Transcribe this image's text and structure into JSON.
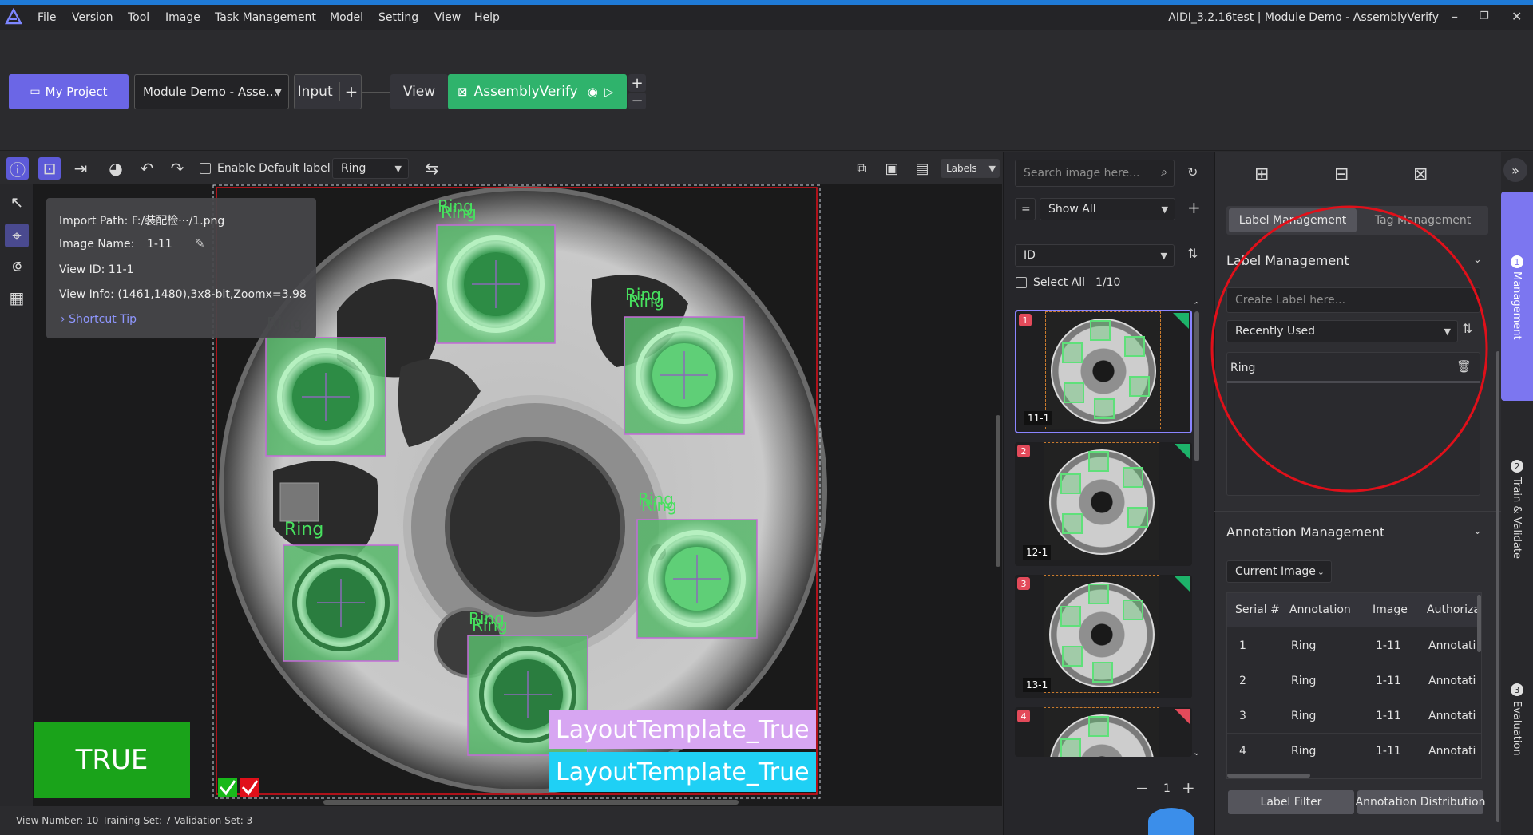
{
  "title_bar": {
    "window_title": "AIDI_3.2.16test | Module Demo - AssemblyVerify",
    "menu": [
      "File",
      "Version",
      "Tool",
      "Image",
      "Task Management",
      "Model",
      "Setting",
      "View",
      "Help"
    ]
  },
  "project_bar": {
    "my_project": "My Project",
    "project_select": "Module Demo - Asse...",
    "input_label": "Input",
    "view_label": "View",
    "module_label": "AssemblyVerify",
    "plus": "+",
    "minus": "−"
  },
  "toolbar": {
    "enable_default_label": "Enable Default label",
    "default_label_value": "Ring",
    "labels_select": "Labels"
  },
  "info_popup": {
    "import_path": "Import Path: F:/装配检···/1.png",
    "image_name_key": "Image Name:",
    "image_name_val": "1-11",
    "view_id": "View ID: 11-1",
    "view_info": "View Info: (1461,1480),3x8-bit,Zoomx=3.98",
    "shortcut_tip": "Shortcut Tip"
  },
  "canvas": {
    "ring_label": "Ring",
    "result_badge": "TRUE",
    "layout_label_1": "LayoutTemplate_True",
    "layout_label_2": "LayoutTemplate_True"
  },
  "status_bar": {
    "view_number": "View Number: 10",
    "training_set": "Training Set: 7",
    "validation_set": "Validation Set: 3"
  },
  "gallery": {
    "search_placeholder": "Search image here...",
    "filter_eq": "=",
    "filter_value": "Show All",
    "sort_value": "ID",
    "select_all": "Select All",
    "count": "1/10",
    "thumbnails": [
      {
        "num": "1",
        "label": "11-1",
        "corner_color": "#1db36a"
      },
      {
        "num": "2",
        "label": "12-1",
        "corner_color": "#1db36a"
      },
      {
        "num": "3",
        "label": "13-1",
        "corner_color": "#1db36a"
      },
      {
        "num": "4",
        "label": "",
        "corner_color": "#e34a5a"
      }
    ],
    "page": "1"
  },
  "right_panel": {
    "tab_label_mgmt": "Label Management",
    "tab_tag_mgmt": "Tag Management",
    "section_label_mgmt": "Label Management",
    "create_label_placeholder": "Create Label here...",
    "recently_used": "Recently Used",
    "labels": [
      "Ring"
    ],
    "section_annotation_mgmt": "Annotation Management",
    "current_image": "Current Image",
    "table_headers": [
      "Serial #",
      "Annotation",
      "Image",
      "Authoriza"
    ],
    "table_rows": [
      [
        "1",
        "Ring",
        "1-11",
        "Annotati"
      ],
      [
        "2",
        "Ring",
        "1-11",
        "Annotati"
      ],
      [
        "3",
        "Ring",
        "1-11",
        "Annotati"
      ],
      [
        "4",
        "Ring",
        "1-11",
        "Annotati"
      ]
    ],
    "label_filter": "Label Filter",
    "annotation_distribution": "Annotation Distribution"
  },
  "side_tabs": {
    "management": "Management",
    "train_validate": "Train & Validate",
    "evaluation": "Evaluation",
    "n1": "1",
    "n2": "2",
    "n3": "3"
  },
  "colors": {
    "accent": "#6b66e6",
    "module_green": "#2fb36c",
    "true_green": "#1aa31a",
    "layout_purple": "#d7a6f2",
    "layout_cyan": "#1fd0f5",
    "annotation_red": "#e0101a"
  }
}
